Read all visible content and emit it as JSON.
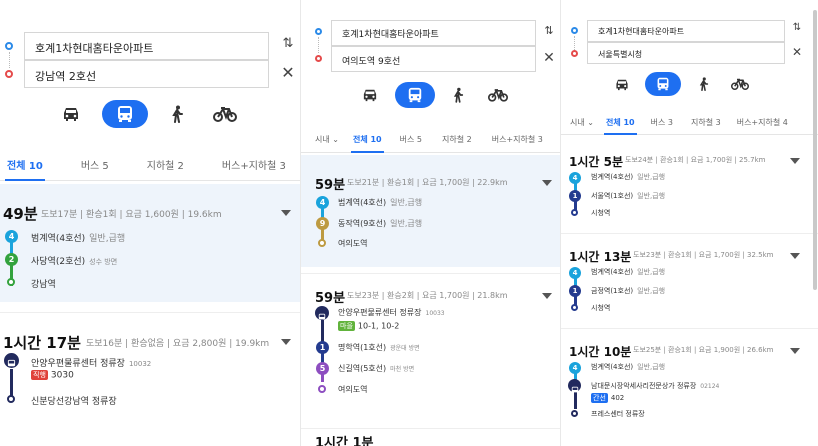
{
  "panels": [
    {
      "origin": "호계1차현대홈타운아파트",
      "destination": "강남역 2호선",
      "filter": "",
      "tabs": [
        "전체 10",
        "버스 5",
        "지하철 2",
        "버스+지하철 3"
      ],
      "routes": [
        {
          "time": "49분",
          "meta": "도보17분 | 환승1회 | 요금 1,600원 | 19.6km",
          "steps": [
            {
              "badge": "4",
              "color": "#1aa3dc",
              "name": "범계역(4호선)",
              "dir": "일반,급행"
            },
            {
              "badge": "2",
              "color": "#33a23d",
              "name": "사당역(2호선)",
              "dir": "성수 방면"
            },
            {
              "ring": "#33a23d",
              "name": "강남역",
              "dir": ""
            }
          ]
        },
        {
          "time": "1시간 17분",
          "meta": "도보16분 | 환승없음 | 요금 2,800원 | 19.9km",
          "steps": [
            {
              "busicon": true,
              "color": "#222a5e",
              "name": "안양우편물류센터 정류장",
              "dir": "10032",
              "tag": "직행",
              "tagColor": "#e0413a",
              "route": "3030"
            },
            {
              "ring": "#222a5e",
              "name": "신분당선강남역 정류장",
              "dir": ""
            }
          ]
        }
      ]
    },
    {
      "origin": "호계1차현대홈타운아파트",
      "destination": "여의도역 9호선",
      "filter": "시내",
      "tabs": [
        "전체 10",
        "버스 5",
        "지하철 2",
        "버스+지하철 3"
      ],
      "routes": [
        {
          "time": "59분",
          "meta": "도보21분 | 환승1회 | 요금 1,700원 | 22.9km",
          "steps": [
            {
              "badge": "4",
              "color": "#1aa3dc",
              "name": "범계역(4호선)",
              "dir": "일반,급행"
            },
            {
              "badge": "9",
              "color": "#bd9a41",
              "name": "동작역(9호선)",
              "dir": "일반,급행"
            },
            {
              "ring": "#bd9a41",
              "name": "여의도역",
              "dir": ""
            }
          ]
        },
        {
          "time": "59분",
          "meta": "도보23분 | 환승2회 | 요금 1,700원 | 21.8km",
          "steps": [
            {
              "busicon": true,
              "color": "#222a5e",
              "name": "안양우편물류센터 정류장",
              "dir": "10033",
              "tag": "마을",
              "tagColor": "#61b33c",
              "route": "10-1, 10-2"
            },
            {
              "badge": "1",
              "color": "#243b8f",
              "name": "명학역(1호선)",
              "dir": "광운대 방면"
            },
            {
              "badge": "5",
              "color": "#8d4ec0",
              "name": "신길역(5호선)",
              "dir": "마천 방면"
            },
            {
              "ring": "#8d4ec0",
              "name": "여의도역",
              "dir": ""
            }
          ]
        }
      ],
      "cut_text": "1시간 1분"
    },
    {
      "origin": "호계1차현대홈타운아파트",
      "destination": "서울특별시청",
      "filter": "시내",
      "tabs": [
        "전체 10",
        "버스 3",
        "지하철 3",
        "버스+지하철 4"
      ],
      "routes": [
        {
          "time": "1시간 5분",
          "meta": "도보24분 | 환승1회 | 요금 1,700원 | 25.7km",
          "steps": [
            {
              "badge": "4",
              "color": "#1aa3dc",
              "name": "범계역(4호선)",
              "dir": "일반,급행"
            },
            {
              "badge": "1",
              "color": "#243b8f",
              "name": "서울역(1호선)",
              "dir": "일반,급행"
            },
            {
              "ring": "#243b8f",
              "name": "시청역",
              "dir": ""
            }
          ]
        },
        {
          "time": "1시간 13분",
          "meta": "도보23분 | 환승1회 | 요금 1,700원 | 32.5km",
          "steps": [
            {
              "badge": "4",
              "color": "#1aa3dc",
              "name": "범계역(4호선)",
              "dir": "일반,급행"
            },
            {
              "badge": "1",
              "color": "#243b8f",
              "name": "금정역(1호선)",
              "dir": "일반,급행"
            },
            {
              "ring": "#243b8f",
              "name": "시청역",
              "dir": ""
            }
          ]
        },
        {
          "time": "1시간 10분",
          "meta": "도보25분 | 환승1회 | 요금 1,900원 | 26.6km",
          "steps": [
            {
              "badge": "4",
              "color": "#1aa3dc",
              "name": "범계역(4호선)",
              "dir": "일반,급행"
            },
            {
              "busicon": true,
              "color": "#222a5e",
              "name": "남대문시장악세사리전문상가 정류장",
              "dir": "02124",
              "tag": "간선",
              "tagColor": "#1e6ff1",
              "route": "402"
            },
            {
              "ring": "#222a5e",
              "name": "프레스센터 정류장",
              "dir": ""
            }
          ]
        }
      ]
    }
  ],
  "colors": {
    "accent": "#1e6ff1",
    "origin": "#2b8ae8",
    "destination": "#e54b4b"
  }
}
